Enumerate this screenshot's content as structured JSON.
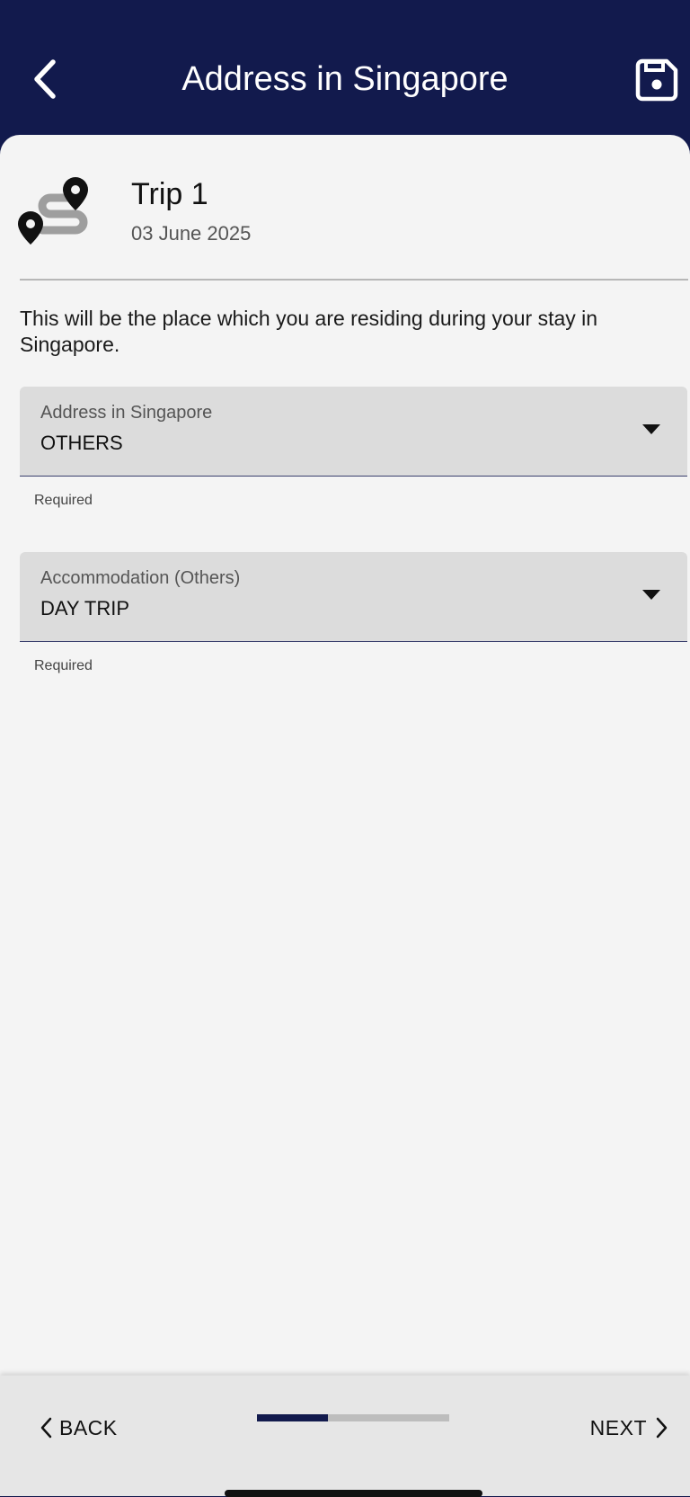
{
  "header": {
    "title": "Address in Singapore",
    "back_icon": "chevron-left",
    "save_icon": "floppy-disk"
  },
  "trip": {
    "name": "Trip 1",
    "date": "03 June 2025",
    "icon": "route-pins"
  },
  "description": "This will be the place which you are residing during your stay in Singapore.",
  "fields": [
    {
      "label": "Address in Singapore",
      "value": "OTHERS",
      "helper": "Required"
    },
    {
      "label": "Accommodation (Others)",
      "value": "DAY TRIP",
      "helper": "Required"
    }
  ],
  "footer": {
    "back_label": "BACK",
    "next_label": "NEXT",
    "progress": 0.37
  },
  "colors": {
    "primary": "#121a4d",
    "background": "#f4f4f4",
    "field": "#dcdcdc"
  }
}
